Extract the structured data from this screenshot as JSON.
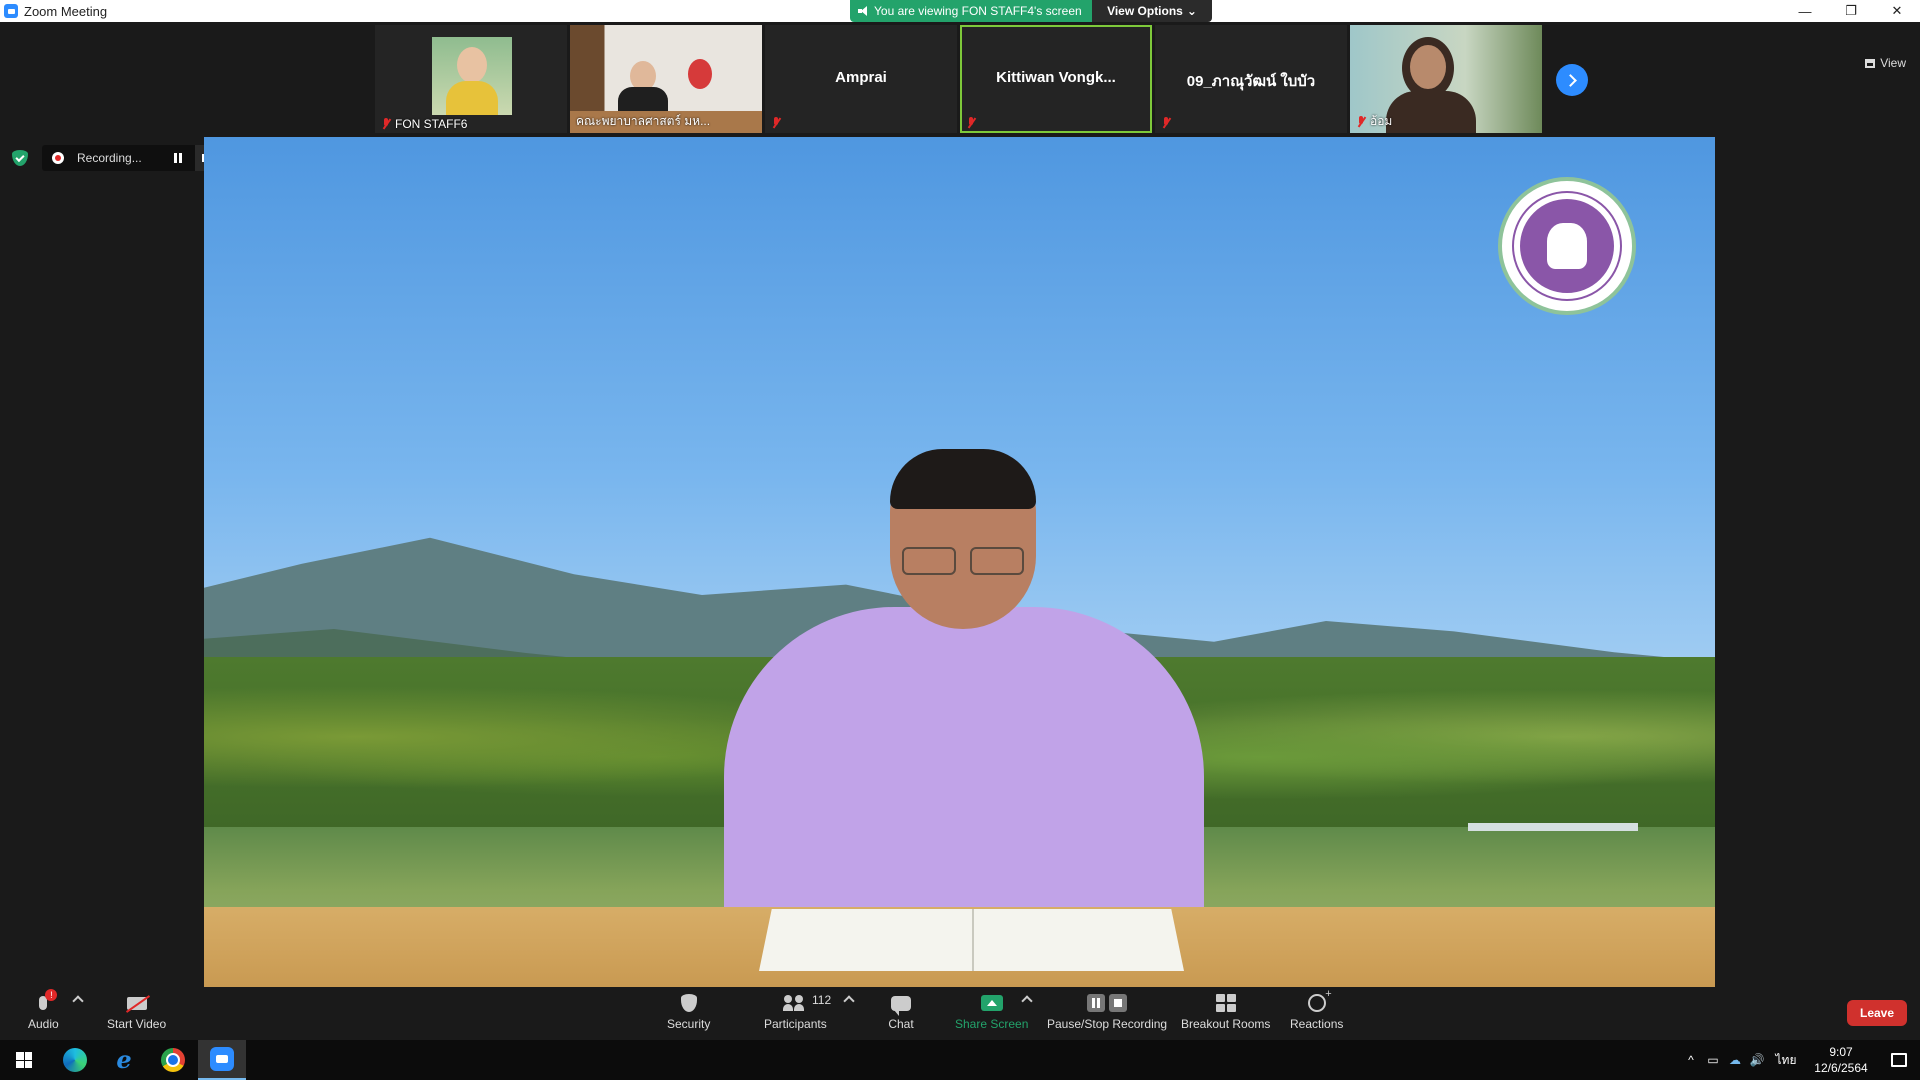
{
  "window": {
    "title": "Zoom Meeting",
    "minimize": "—",
    "restore": "❐",
    "close": "✕"
  },
  "banner": {
    "viewing_text": "You are viewing FON STAFF4's screen",
    "view_options": "View Options",
    "accent": "#23a36b"
  },
  "gallery": {
    "tiles": [
      {
        "name": "FON STAFF6",
        "muted": true
      },
      {
        "name": "คณะพยาบาลศาสตร์ มห...",
        "muted": true
      },
      {
        "name": "Amprai",
        "muted": true
      },
      {
        "name": "Kittiwan  Vongk...",
        "muted": true,
        "active": true
      },
      {
        "name": "09_ภาณุวัฒน์ ใบบัว",
        "muted": true
      },
      {
        "name": "อ้อม",
        "muted": true
      }
    ],
    "view_label": "View"
  },
  "recording": {
    "status": "Recording..."
  },
  "toolbar": {
    "audio_label": "Audio",
    "audio_alert": "!",
    "video_label": "Start Video",
    "security_label": "Security",
    "participants_label": "Participants",
    "participants_count": "112",
    "chat_label": "Chat",
    "share_label": "Share Screen",
    "recording_label": "Pause/Stop Recording",
    "breakout_label": "Breakout Rooms",
    "reactions_label": "Reactions",
    "leave_label": "Leave",
    "share_color": "#23a36b",
    "leave_color": "#d0312d"
  },
  "taskbar": {
    "ime": "ไทย",
    "time": "9:07",
    "date": "12/6/2564",
    "tray_caret": "^",
    "volume": "🔊"
  }
}
